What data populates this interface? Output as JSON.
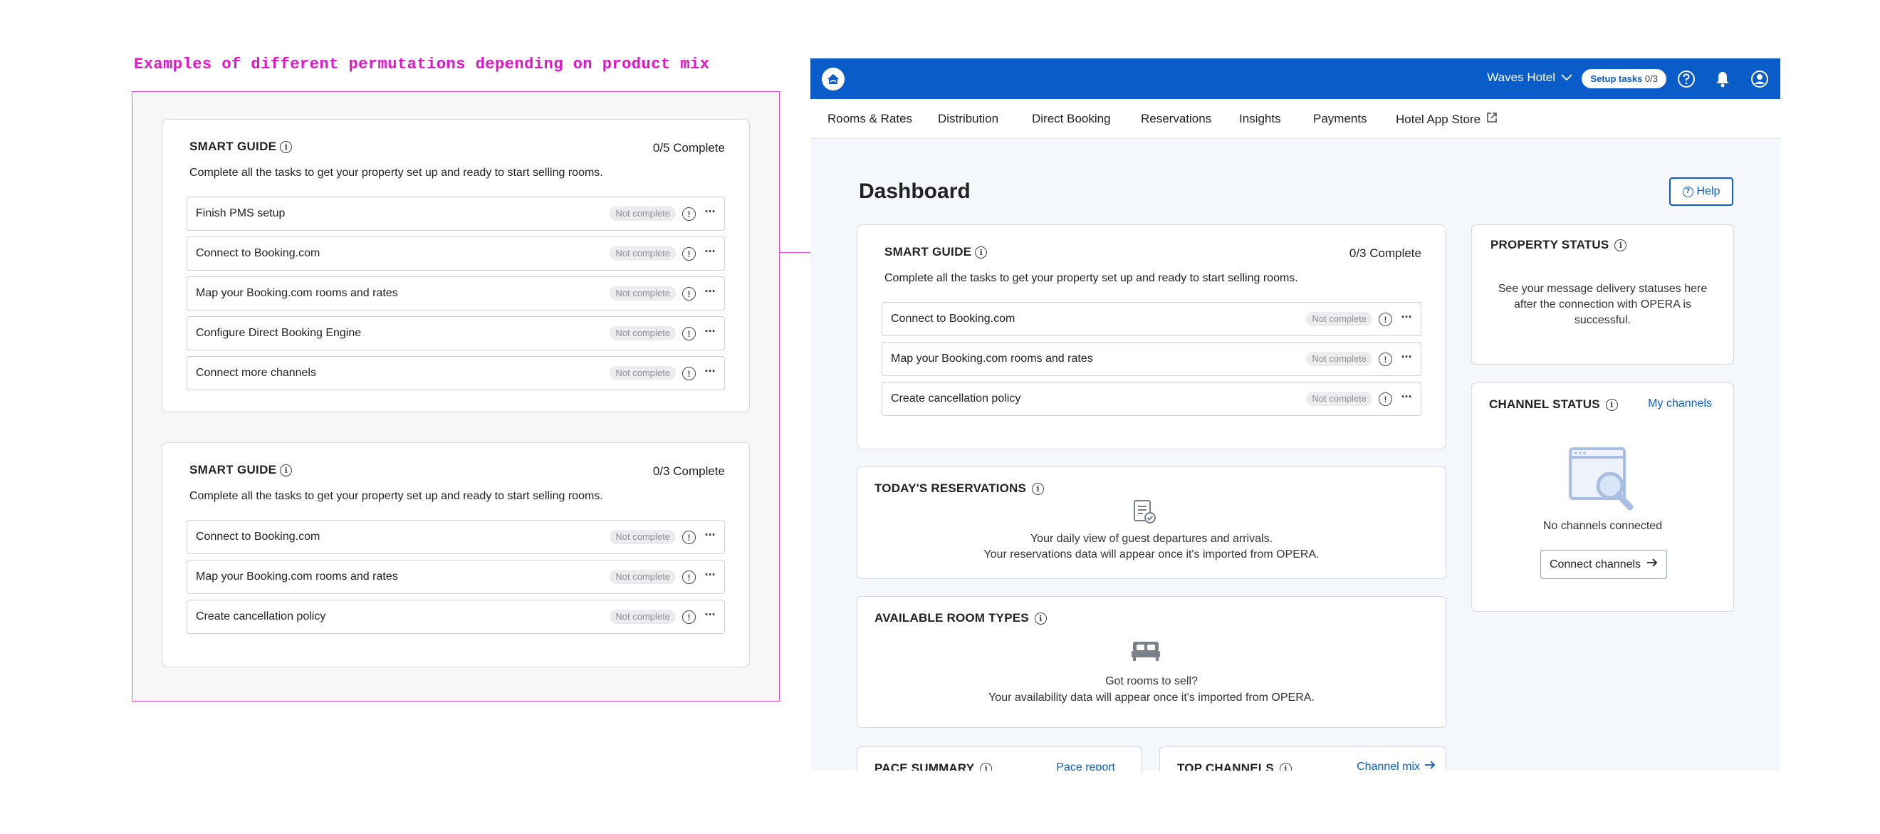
{
  "annotation": {
    "title": "Examples of different permutations depending on product mix"
  },
  "example_five": {
    "title": "SMART GUIDE",
    "progress": "0/5 Complete",
    "description": "Complete all the tasks to get your property set up and ready to start selling rooms.",
    "tasks": [
      {
        "label": "Finish PMS setup",
        "status": "Not complete"
      },
      {
        "label": "Connect to Booking.com",
        "status": "Not complete"
      },
      {
        "label": "Map your Booking.com rooms and rates",
        "status": "Not complete"
      },
      {
        "label": "Configure Direct Booking Engine",
        "status": "Not complete"
      },
      {
        "label": "Connect more channels",
        "status": "Not complete"
      }
    ]
  },
  "example_three": {
    "title": "SMART GUIDE",
    "progress": "0/3 Complete",
    "description": "Complete all the tasks to get your property set up and ready to start selling rooms.",
    "tasks": [
      {
        "label": "Connect to Booking.com",
        "status": "Not complete"
      },
      {
        "label": "Map your Booking.com rooms and rates",
        "status": "Not complete"
      },
      {
        "label": "Create cancellation policy",
        "status": "Not complete"
      }
    ]
  },
  "topbar": {
    "hotel_name": "Waves Hotel",
    "setup_label": "Setup tasks",
    "setup_count": "0/3",
    "icons": [
      "home-logo-icon",
      "chevron-down-icon",
      "help-circle-icon",
      "bell-icon",
      "user-circle-icon"
    ],
    "brand_color": "#0a5dc8"
  },
  "nav": {
    "items": [
      "Rooms & Rates",
      "Distribution",
      "Direct Booking",
      "Reservations",
      "Insights",
      "Payments",
      "Hotel App Store"
    ]
  },
  "dashboard": {
    "title": "Dashboard",
    "help_label": "Help",
    "smart_guide": {
      "title": "SMART GUIDE",
      "progress": "0/3 Complete",
      "description": "Complete all the tasks to get your property set up and ready to start selling rooms.",
      "tasks": [
        {
          "label": "Connect to Booking.com",
          "status": "Not complete"
        },
        {
          "label": "Map your Booking.com rooms and rates",
          "status": "Not complete"
        },
        {
          "label": "Create cancellation policy",
          "status": "Not complete"
        }
      ]
    },
    "reservations": {
      "title": "TODAY'S RESERVATIONS",
      "line1": "Your daily view of guest departures and arrivals.",
      "line2": "Your reservations data will appear once it's imported from OPERA."
    },
    "room_types": {
      "title": "AVAILABLE ROOM TYPES",
      "line1": "Got rooms to sell?",
      "line2": "Your availability data will appear once it's imported from OPERA."
    },
    "pace_summary": {
      "title": "PACE SUMMARY",
      "link": "Pace report"
    },
    "top_channels": {
      "title": "TOP CHANNELS",
      "link": "Channel mix"
    },
    "property_status": {
      "title": "PROPERTY STATUS",
      "line1": "See your message delivery statuses here",
      "line2": "after the connection with OPERA is",
      "line3": "successful."
    },
    "channel_status": {
      "title": "CHANNEL STATUS",
      "link": "My channels",
      "empty_text": "No channels connected",
      "button_label": "Connect channels"
    }
  }
}
